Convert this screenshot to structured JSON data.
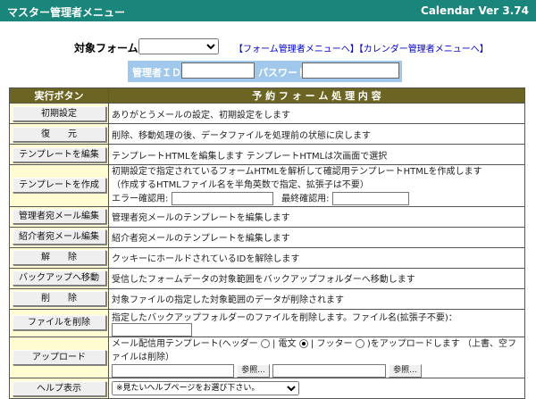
{
  "title": "マスター管理者メニュー",
  "version": "Calendar Ver 3.74",
  "form_select": {
    "label": "対象フォーム：",
    "selected": "",
    "link_form_admin": "【フォーム管理者メニューへ】",
    "link_calendar_admin": "【カレンダー管理者メニューへ】"
  },
  "login": {
    "id_label": "管理者ＩＤ",
    "password_label": "パスワード"
  },
  "table": {
    "header_button": "実行ボタン",
    "header_desc": "予 約 フ ォ ー ム 処 理 内 容",
    "rows": [
      {
        "button": "初期設定",
        "desc": "ありがとうメールの設定、初期設定をします"
      },
      {
        "button": "復　　元",
        "desc": "削除、移動処理の後、データファイルを処理前の状態に戻します"
      },
      {
        "button": "テンプレートを編集",
        "desc": "テンプレートHTMLを編集します テンプレートHTMLは次画面で選択"
      },
      {
        "button": "テンプレートを作成",
        "desc": "初期設定で指定されているフォームHTMLを解析して確認用テンプレートHTMLを作成します",
        "desc2": "（作成するHTMLファイル名を半角英数で指定、拡張子は不要）",
        "error_label": "エラー確認用:",
        "final_label": "最終確認用:"
      },
      {
        "button": "管理者宛メール編集",
        "desc": "管理者宛メールのテンプレートを編集します"
      },
      {
        "button": "紹介者宛メール編集",
        "desc": "紹介者宛メールのテンプレートを編集します"
      },
      {
        "button": "解　　除",
        "desc": "クッキーにホールドされているIDを解除します"
      },
      {
        "button": "バックアップへ移動",
        "desc": "受信したフォームデータの対象範囲をバックアップフォルダーへ移動します"
      },
      {
        "button": "削　　除",
        "desc": "対象ファイルの指定した対象範囲のデータが削除されます"
      },
      {
        "button": "ファイルを削除",
        "desc": "指定したバックアップフォルダーのファイルを削除します。ファイル名(拡張子不要)："
      },
      {
        "button": "アップロード",
        "desc_a": "メール配信用テンプレート(ヘッダー",
        "desc_b": "| 電文",
        "desc_c": "| フッター",
        "desc_d": ")をアップロードします （上書、空ファイルは削除）",
        "browse": "参照..."
      },
      {
        "button": "ヘルプ表示",
        "help_select": "※見たいヘルプページをお選び下さい。"
      }
    ]
  }
}
